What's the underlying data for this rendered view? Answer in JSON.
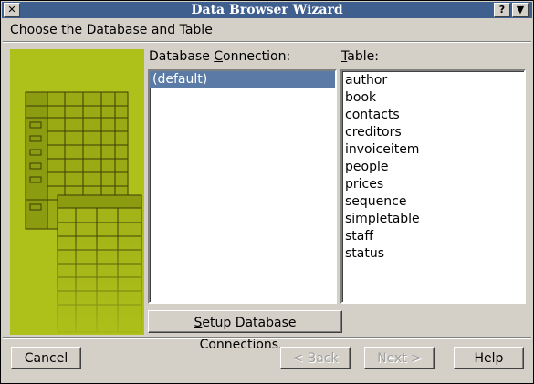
{
  "window": {
    "title": "Data Browser Wizard",
    "close_glyph": "✕",
    "help_glyph": "?",
    "menu_glyph": "▼"
  },
  "heading": "Choose the Database and Table",
  "connection": {
    "label_pre": "Database ",
    "label_mnemonic": "C",
    "label_post": "onnection:",
    "items": [
      "(default)"
    ],
    "selected_index": 0
  },
  "table": {
    "label_mnemonic": "T",
    "label_post": "able:",
    "items": [
      "author",
      "book",
      "contacts",
      "creditors",
      "invoiceitem",
      "people",
      "prices",
      "sequence",
      "simpletable",
      "staff",
      "status"
    ]
  },
  "setup_button": {
    "mnemonic": "S",
    "rest": "etup Database Connections..."
  },
  "footer": {
    "cancel": "Cancel",
    "back": "< Back",
    "next": "Next >",
    "help": "Help"
  },
  "colors": {
    "art_background": "#aec01a",
    "selection": "#5b7ba6",
    "titlebar": "#3f5f8f"
  }
}
